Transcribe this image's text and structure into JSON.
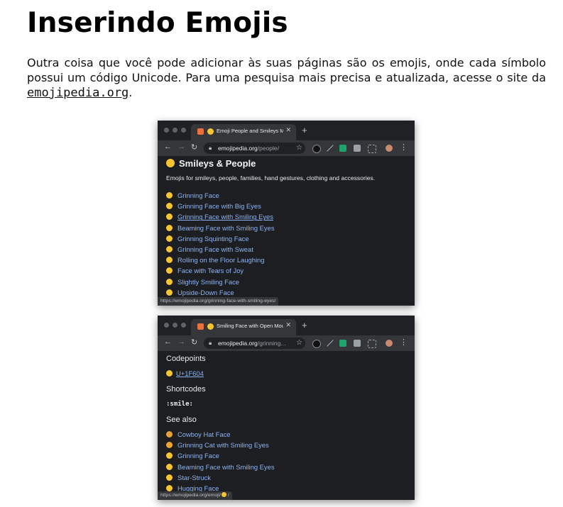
{
  "document": {
    "title": "Inserindo Emojis",
    "intro": "Outra coisa que você pode adicionar às suas páginas são os emojis, onde cada símbolo possui um código Unicode. Para uma pesquisa mais precisa e atualizada, acesse o site da ",
    "link_text": "emojipedia.org",
    "intro_end": "."
  },
  "browser1": {
    "tab_title": "Emoji People and Smileys Me",
    "url_host": "emojipedia.org",
    "url_path": "/people/",
    "heading": "Smileys & People",
    "description": "Emojis for smileys, people, families, hand gestures, clothing and accessories.",
    "items": [
      "Grinning Face",
      "Grinning Face with Big Eyes",
      "Grinning Face with Smiling Eyes",
      "Beaming Face with Smiling Eyes",
      "Grinning Squinting Face",
      "Grinning Face with Sweat",
      "Rolling on the Floor Laughing",
      "Face with Tears of Joy",
      "Slightly Smiling Face",
      "Upside-Down Face"
    ],
    "status": "https://emojipedia.org/grinning-face-with-smiling-eyes/"
  },
  "browser2": {
    "tab_title": "Smiling Face with Open Mou",
    "url_host": "emojipedia.org",
    "url_path": "/grinning...",
    "codepoints_label": "Codepoints",
    "codepoint": "U+1F604",
    "shortcodes_label": "Shortcodes",
    "shortcode": ":smile:",
    "see_also_label": "See also",
    "items": [
      "Cowboy Hat Face",
      "Grinning Cat with Smiling Eyes",
      "Grinning Face",
      "Beaming Face with Smiling Eyes",
      "Star-Struck",
      "Hugging Face"
    ],
    "status": "https://emojipedia.org/emoji/",
    "status_suffix": " /"
  },
  "colors": {
    "link": "#8ab4f8",
    "emoji": "#f7c531",
    "browser_bg": "#1d1e21"
  }
}
